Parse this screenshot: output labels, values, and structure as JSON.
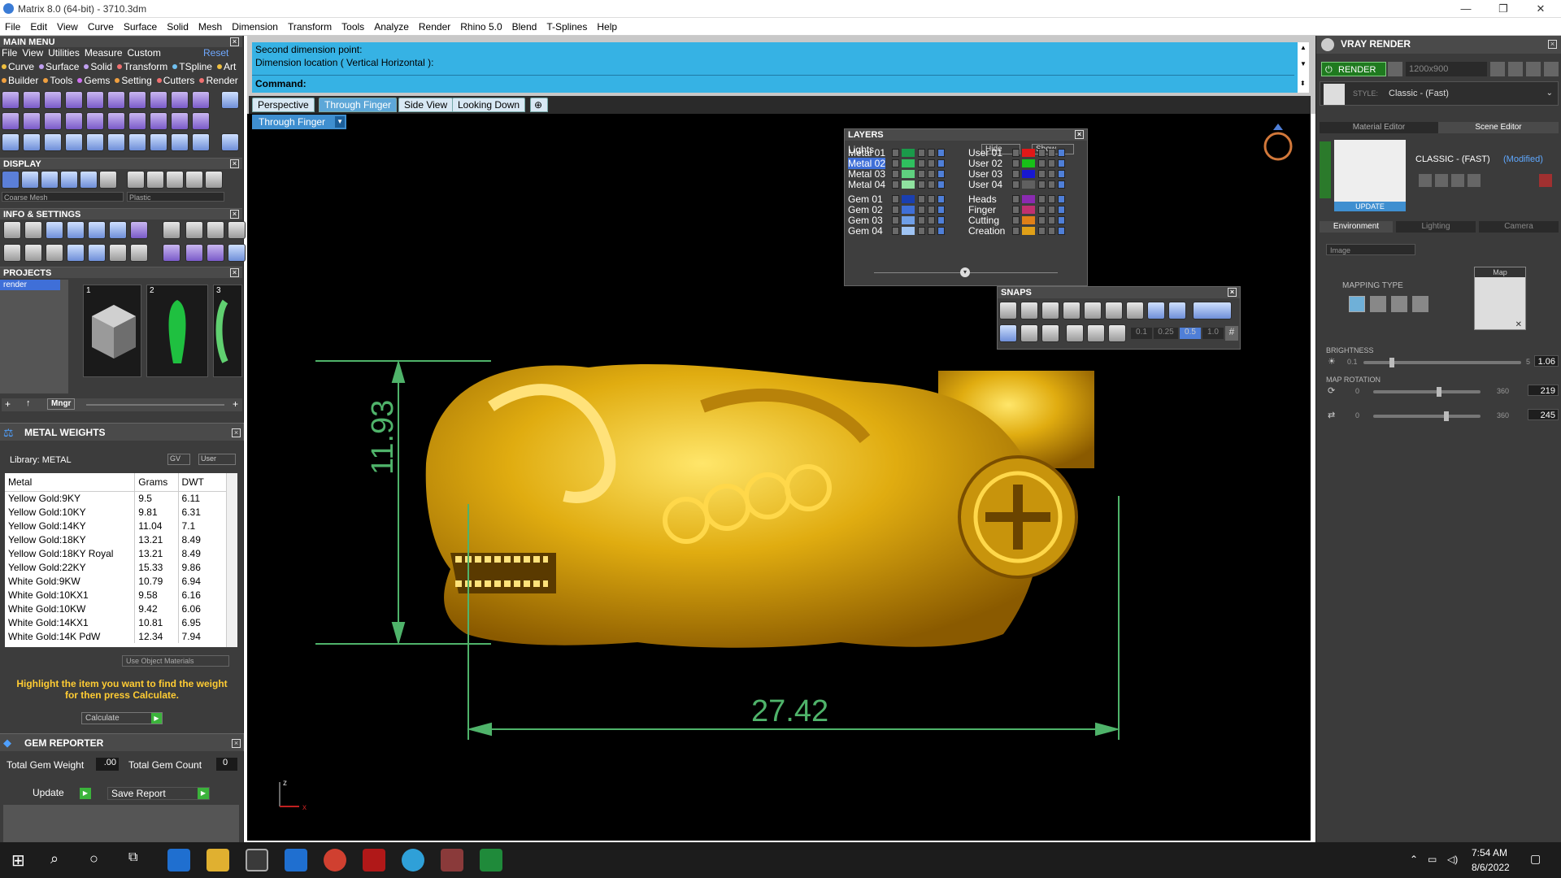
{
  "window": {
    "title": "Matrix 8.0 (64-bit) - 3710.3dm",
    "min": "—",
    "max": "❐",
    "close": "✕"
  },
  "menu": [
    "File",
    "Edit",
    "View",
    "Curve",
    "Surface",
    "Solid",
    "Mesh",
    "Dimension",
    "Transform",
    "Tools",
    "Analyze",
    "Render",
    "Rhino 5.0",
    "Blend",
    "T-Splines",
    "Help"
  ],
  "main_menu": {
    "title": "MAIN MENU",
    "row1": [
      "File",
      "View",
      "Utilities",
      "Measure",
      "Custom"
    ],
    "reset": "Reset",
    "row2": [
      "Curve",
      "Surface",
      "Solid",
      "Transform",
      "TSpline",
      "Art"
    ],
    "row3": [
      "Builder",
      "Tools",
      "Gems",
      "Setting",
      "Cutters",
      "Render"
    ]
  },
  "display": {
    "title": "DISPLAY",
    "mesh_select": "Coarse Mesh",
    "material_select": "Plastic"
  },
  "info": {
    "title": "INFO & SETTINGS"
  },
  "projects": {
    "title": "PROJECTS",
    "selected": "render",
    "thumbs": [
      "1",
      "2",
      "3"
    ],
    "mngr": "Mngr"
  },
  "metal_weights": {
    "title": "METAL WEIGHTS",
    "library": "Library: METAL",
    "gv": "GV",
    "user": "User",
    "columns": [
      "Metal",
      "Grams",
      "DWT"
    ],
    "rows": [
      [
        "Yellow Gold:9KY",
        "9.5",
        "6.11"
      ],
      [
        "Yellow Gold:10KY",
        "9.81",
        "6.31"
      ],
      [
        "Yellow Gold:14KY",
        "11.04",
        "7.1"
      ],
      [
        "Yellow Gold:18KY",
        "13.21",
        "8.49"
      ],
      [
        "Yellow Gold:18KY Royal",
        "13.21",
        "8.49"
      ],
      [
        "Yellow Gold:22KY",
        "15.33",
        "9.86"
      ],
      [
        "White Gold:9KW",
        "10.79",
        "6.94"
      ],
      [
        "White Gold:10KX1",
        "9.58",
        "6.16"
      ],
      [
        "White Gold:10KW",
        "9.42",
        "6.06"
      ],
      [
        "White Gold:14KX1",
        "10.81",
        "6.95"
      ],
      [
        "White Gold:14K PdW",
        "12.34",
        "7.94"
      ]
    ],
    "use_object_materials": "Use Object Materials",
    "hint": "Highlight the item you want to find the weight for then press Calculate.",
    "calculate": "Calculate"
  },
  "gem_reporter": {
    "title": "GEM REPORTER",
    "total_weight_label": "Total Gem Weight",
    "total_weight": ".00",
    "total_count_label": "Total Gem Count",
    "total_count": "0",
    "update": "Update",
    "save_report": "Save Report"
  },
  "command": {
    "line1": "Second dimension point:",
    "line2": "Dimension location ( Vertical  Horizontal ):",
    "prompt": "Command:"
  },
  "view_tabs": [
    "Perspective",
    "Through Finger",
    "Side View",
    "Looking Down"
  ],
  "active_view": "Through Finger",
  "dimensions": {
    "vertical": "11.93",
    "horizontal": "27.42"
  },
  "axis": {
    "z": "z",
    "x": "x"
  },
  "layers": {
    "title": "LAYERS",
    "lights": "Lights",
    "hide": "Hide",
    "show": "Show",
    "left": [
      {
        "name": "Metal 01",
        "color": "#1a9a4a"
      },
      {
        "name": "Metal 02",
        "color": "#2fbf5f"
      },
      {
        "name": "Metal 03",
        "color": "#5fd07f"
      },
      {
        "name": "Metal 04",
        "color": "#8fe29f"
      },
      {
        "name": "Gem 01",
        "color": "#1a3fb0"
      },
      {
        "name": "Gem 02",
        "color": "#3f6fd8"
      },
      {
        "name": "Gem 03",
        "color": "#6f9fe8"
      },
      {
        "name": "Gem 04",
        "color": "#9fc4f4"
      }
    ],
    "right": [
      {
        "name": "User 01",
        "color": "#e01818"
      },
      {
        "name": "User 02",
        "color": "#18c018"
      },
      {
        "name": "User 03",
        "color": "#1818d0"
      },
      {
        "name": "User 04",
        "color": "#606060"
      },
      {
        "name": "Heads",
        "color": "#8a2ab0"
      },
      {
        "name": "Finger",
        "color": "#c03070"
      },
      {
        "name": "Cutting",
        "color": "#e08018"
      },
      {
        "name": "Creation",
        "color": "#e0a018"
      }
    ]
  },
  "snaps": {
    "title": "SNAPS",
    "values": [
      "0.1",
      "0.25",
      "0.5",
      "1.0"
    ]
  },
  "vray": {
    "title": "VRAY RENDER",
    "render": "RENDER",
    "resolution": "1200x900",
    "style_label": "STYLE:",
    "style_value": "Classic - (Fast)",
    "tabs": [
      "Material Editor",
      "Scene Editor"
    ],
    "preset_name": "CLASSIC - (FAST)",
    "modified": "(Modified)",
    "update": "UPDATE",
    "subtabs": [
      "Environment",
      "Lighting",
      "Camera"
    ],
    "env_select": "Image",
    "mapping_type": "MAPPING TYPE",
    "map": "Map",
    "brightness": {
      "label": "BRIGHTNESS",
      "min": "0.1",
      "max": "5",
      "value": "1.06",
      "level": 0.18
    },
    "map_rotation": {
      "label": "MAP ROTATION",
      "min": "0",
      "max": "360",
      "value": "219",
      "level": 0.61
    },
    "map_rotation2": {
      "min": "0",
      "max": "360",
      "value": "245",
      "level": 0.68
    }
  },
  "taskbar": {
    "time": "7:54 AM",
    "date": "8/6/2022"
  },
  "colors": {
    "cmd_bg": "#36b2e4",
    "dim_green": "#4fb36a",
    "gold": "#e0ac10",
    "panel": "#3c3c3c"
  }
}
